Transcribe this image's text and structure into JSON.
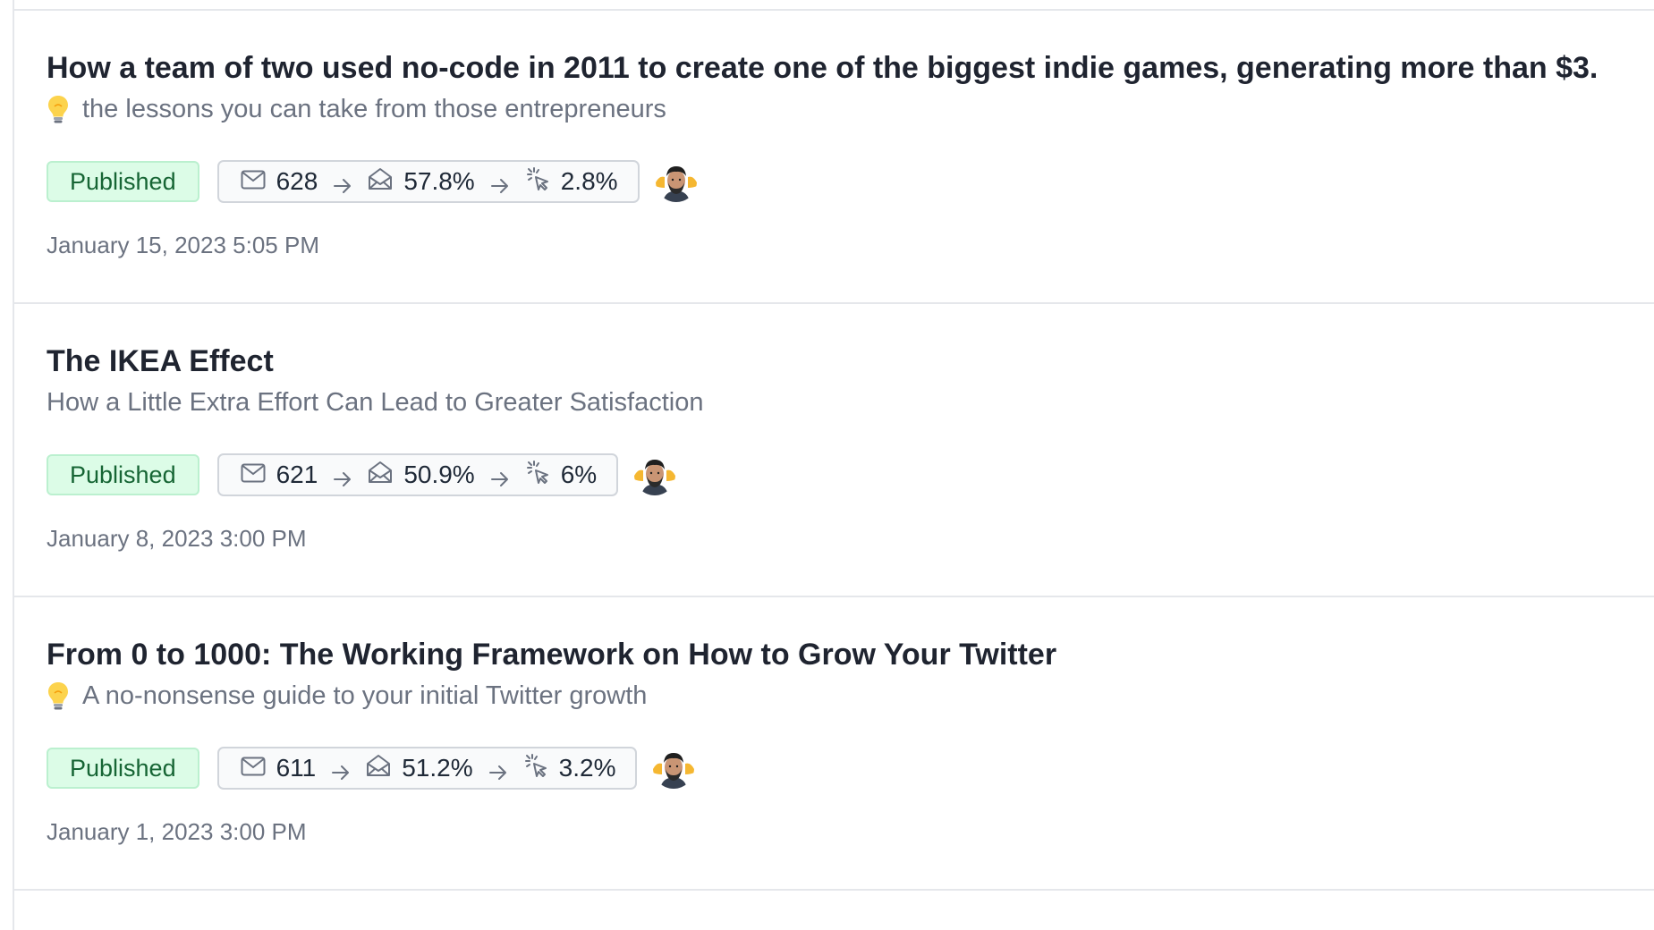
{
  "posts": [
    {
      "title": "How a team of two used no-code in 2011 to create one of the biggest indie games, generating more than $3.",
      "subtitle": "the lessons you can take from those entrepreneurs",
      "has_bulb": true,
      "status": "Published",
      "recipients": "628",
      "open_rate": "57.8%",
      "click_rate": "2.8%",
      "date": "January 15, 2023 5:05 PM"
    },
    {
      "title": "The IKEA Effect",
      "subtitle": "How a Little Extra Effort Can Lead to Greater Satisfaction",
      "has_bulb": false,
      "status": "Published",
      "recipients": "621",
      "open_rate": "50.9%",
      "click_rate": "6%",
      "date": "January 8, 2023 3:00 PM"
    },
    {
      "title": "From 0 to 1000: The Working Framework on How to Grow Your Twitter",
      "subtitle": "A no-nonsense guide to your initial Twitter growth",
      "has_bulb": true,
      "status": "Published",
      "recipients": "611",
      "open_rate": "51.2%",
      "click_rate": "3.2%",
      "date": "January 1, 2023 3:00 PM"
    }
  ],
  "icons": {
    "recipients": "mail-icon",
    "opens": "mail-open-icon",
    "clicks": "cursor-click-icon",
    "arrow": "arrow-right-icon",
    "bulb": "lightbulb-icon"
  },
  "colors": {
    "published_bg": "#dcfce7",
    "published_text": "#166534",
    "title": "#1f2430",
    "muted": "#6b7280",
    "divider": "#e5e7eb"
  }
}
